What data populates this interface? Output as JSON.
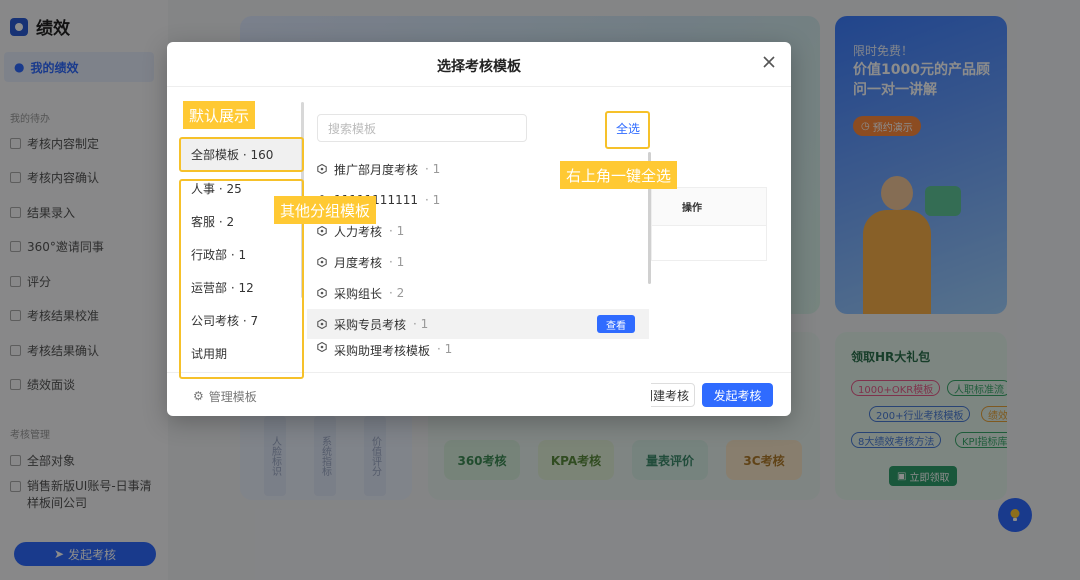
{
  "app": {
    "title": "绩效",
    "nav_active": "我的绩效",
    "group_todo": "我的待办",
    "todo_items": [
      "考核内容制定",
      "考核内容确认",
      "结果录入",
      "360°邀请同事",
      "评分",
      "考核结果校准",
      "考核结果确认",
      "绩效面谈"
    ],
    "group_manage": "考核管理",
    "manage_items": [
      "全部对象",
      "销售新版UI账号-日事清样板间公司"
    ],
    "launch_button": "发起考核"
  },
  "background": {
    "promo_title1": "限时免费！",
    "promo_title2": "价值1000元的产品顾问一对一讲解",
    "promo_button": "预约演示",
    "side_vertical": [
      "人脸标识",
      "系统指标",
      "价值评分"
    ],
    "mid_tags": [
      "360考核",
      "KPA考核",
      "量表评价",
      "3C考核"
    ],
    "gift_title": "领取HR大礼包",
    "gift_pills": [
      "1000+OKR模板",
      "人职标准流",
      "200+行业考核模板",
      "绩效",
      "8大绩效考核方法",
      "KPI指标库"
    ],
    "gift_button": "立即领取"
  },
  "modal": {
    "title": "选择考核模板",
    "search_placeholder": "搜索模板",
    "select_all": "全选",
    "groups": [
      {
        "label": "全部模板 · 160"
      },
      {
        "label": "人事 · 25"
      },
      {
        "label": "客服 · 2"
      },
      {
        "label": "行政部 · 1"
      },
      {
        "label": "运营部 · 12"
      },
      {
        "label": "公司考核 · 7"
      },
      {
        "label": "试用期"
      }
    ],
    "templates": [
      {
        "name": "推广部月度考核",
        "count": "· 1"
      },
      {
        "name": "11111111111",
        "count": "· 1"
      },
      {
        "name": "人力考核",
        "count": "· 1"
      },
      {
        "name": "月度考核",
        "count": "· 1"
      },
      {
        "name": "采购组长",
        "count": "· 2"
      },
      {
        "name": "采购专员考核",
        "count": "· 1"
      },
      {
        "name": "采购助理考核模板",
        "count": "· 1"
      }
    ],
    "view_button": "查看",
    "op_header": "操作",
    "manage_templates": "管理模板",
    "create_button": "创建考核",
    "launch_button": "发起考核"
  },
  "annotations": {
    "default_show": "默认展示",
    "other_groups": "其他分组模板",
    "select_all_hint": "右上角一键全选"
  },
  "colors": {
    "primary": "#2f6bff",
    "annotation": "#ffc933"
  }
}
